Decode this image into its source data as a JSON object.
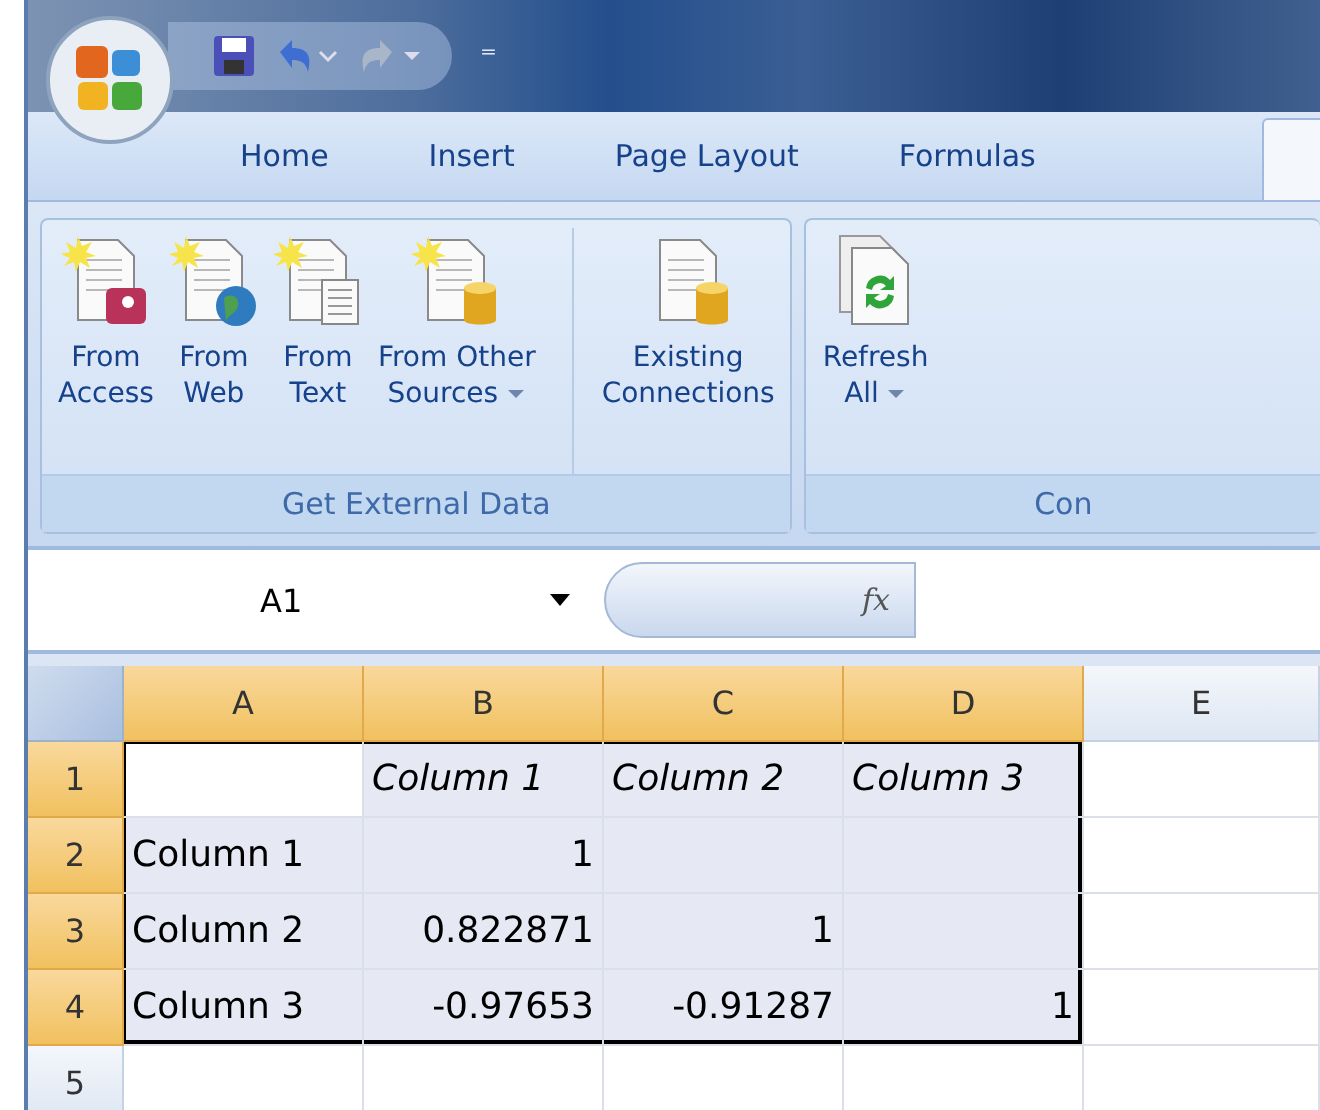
{
  "quick_access": {
    "dropdown_glyph": "⁼"
  },
  "tabs": [
    {
      "label": "Home",
      "selected": false
    },
    {
      "label": "Insert",
      "selected": false
    },
    {
      "label": "Page Layout",
      "selected": false
    },
    {
      "label": "Formulas",
      "selected": false
    }
  ],
  "ribbon": {
    "groups": [
      {
        "label": "Get External Data",
        "buttons": [
          {
            "kind": "access",
            "lines": [
              "From",
              "Access"
            ]
          },
          {
            "kind": "web",
            "lines": [
              "From",
              "Web"
            ]
          },
          {
            "kind": "text",
            "lines": [
              "From",
              "Text"
            ]
          },
          {
            "kind": "other",
            "lines": [
              "From Other",
              "Sources"
            ],
            "dropdown": true
          },
          {
            "kind": "existing",
            "lines": [
              "Existing",
              "Connections"
            ],
            "separated": true
          }
        ]
      },
      {
        "label": "Con",
        "buttons": [
          {
            "kind": "refresh",
            "lines": [
              "Refresh",
              "All"
            ],
            "dropdown": true
          }
        ]
      }
    ]
  },
  "formula_bar": {
    "name_box": "A1",
    "fx": "fx"
  },
  "sheet": {
    "columns": [
      {
        "label": "A",
        "selected": true
      },
      {
        "label": "B",
        "selected": true
      },
      {
        "label": "C",
        "selected": true
      },
      {
        "label": "D",
        "selected": true
      },
      {
        "label": "E",
        "selected": false
      }
    ],
    "rows": [
      {
        "label": "1",
        "selected": true,
        "cells": [
          {
            "selected": false
          },
          {
            "text": "Column 1",
            "kind": "label",
            "selected": true
          },
          {
            "text": "Column 2",
            "kind": "label",
            "selected": true
          },
          {
            "text": "Column 3",
            "kind": "label",
            "selected": true
          },
          {
            "selected": false
          }
        ]
      },
      {
        "label": "2",
        "selected": true,
        "cells": [
          {
            "text": "Column 1",
            "kind": "text",
            "selected": true
          },
          {
            "text": "1",
            "kind": "number",
            "selected": true
          },
          {
            "selected": true
          },
          {
            "selected": true
          },
          {
            "selected": false
          }
        ]
      },
      {
        "label": "3",
        "selected": true,
        "cells": [
          {
            "text": "Column 2",
            "kind": "text",
            "selected": true
          },
          {
            "text": "0.822871",
            "kind": "number",
            "selected": true
          },
          {
            "text": "1",
            "kind": "number",
            "selected": true
          },
          {
            "selected": true
          },
          {
            "selected": false
          }
        ]
      },
      {
        "label": "4",
        "selected": true,
        "cells": [
          {
            "text": "Column 3",
            "kind": "text",
            "selected": true
          },
          {
            "text": "-0.97653",
            "kind": "number",
            "selected": true
          },
          {
            "text": "-0.91287",
            "kind": "number",
            "selected": true
          },
          {
            "text": "1",
            "kind": "number",
            "selected": true
          },
          {
            "selected": false
          }
        ]
      },
      {
        "label": "5",
        "selected": false,
        "cells": [
          {
            "selected": false
          },
          {
            "selected": false
          },
          {
            "selected": false
          },
          {
            "selected": false
          },
          {
            "selected": false
          }
        ]
      }
    ]
  }
}
